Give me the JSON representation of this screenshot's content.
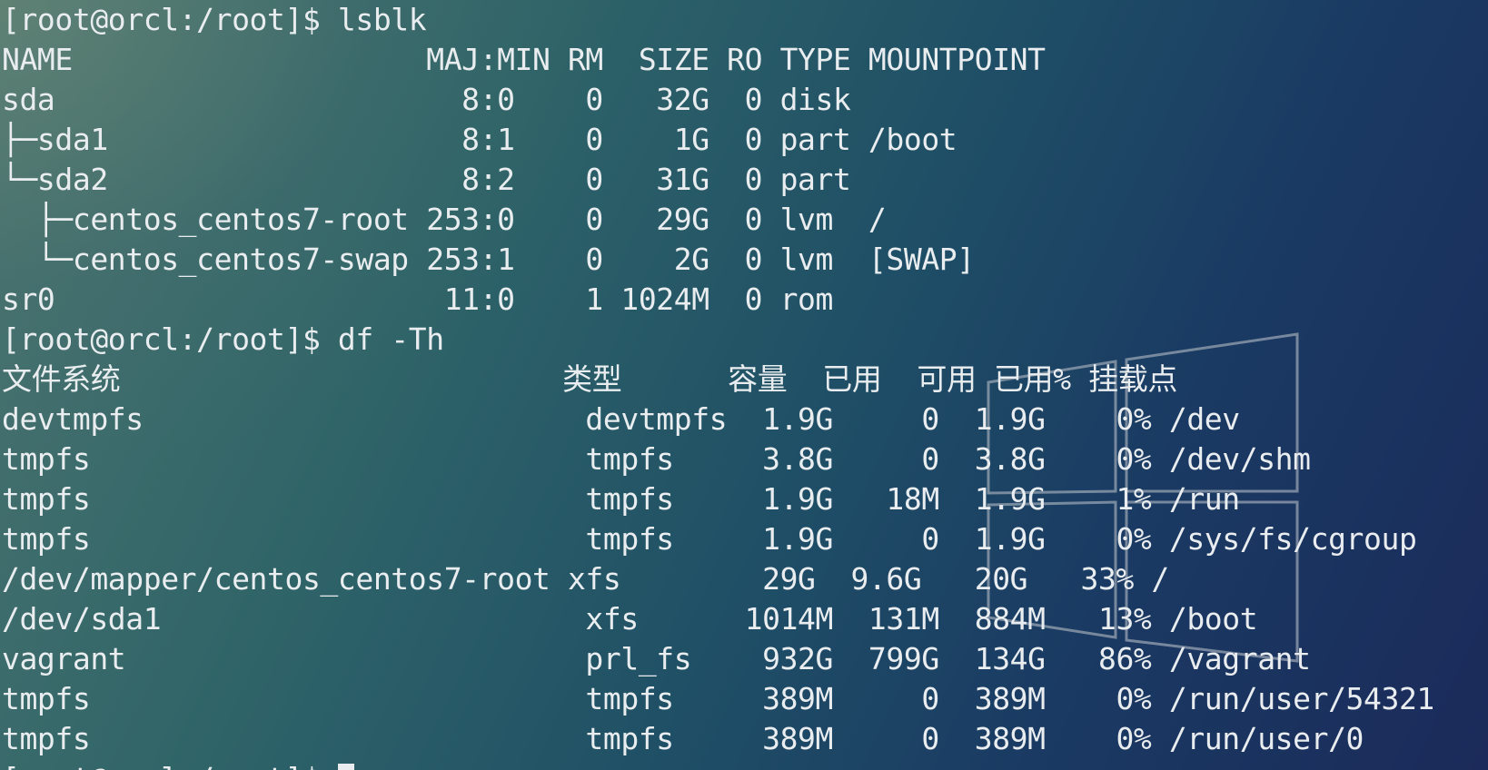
{
  "terminal": {
    "lines": [
      "[root@orcl:/root]$ lsblk",
      "NAME                    MAJ:MIN RM  SIZE RO TYPE MOUNTPOINT",
      "sda                       8:0    0   32G  0 disk",
      "├─sda1                    8:1    0    1G  0 part /boot",
      "└─sda2                    8:2    0   31G  0 part",
      "  ├─centos_centos7-root 253:0    0   29G  0 lvm  /",
      "  └─centos_centos7-swap 253:1    0    2G  0 lvm  [SWAP]",
      "sr0                      11:0    1 1024M  0 rom",
      "[root@orcl:/root]$ df -Th",
      "文件系统                         类型      容量  已用  可用 已用% 挂载点",
      "devtmpfs                         devtmpfs  1.9G     0  1.9G    0% /dev",
      "tmpfs                            tmpfs     3.8G     0  3.8G    0% /dev/shm",
      "tmpfs                            tmpfs     1.9G   18M  1.9G    1% /run",
      "tmpfs                            tmpfs     1.9G     0  1.9G    0% /sys/fs/cgroup",
      "/dev/mapper/centos_centos7-root xfs        29G  9.6G   20G   33% /",
      "/dev/sda1                        xfs      1014M  131M  884M   13% /boot",
      "vagrant                          prl_fs    932G  799G  134G   86% /vagrant",
      "tmpfs                            tmpfs     389M     0  389M    0% /run/user/54321",
      "tmpfs                            tmpfs     389M     0  389M    0% /run/user/0"
    ],
    "prompt": "[root@orcl:/root]$ "
  },
  "colors": {
    "text": "#e9edef",
    "logo_stroke": "#b5bcc4"
  },
  "icons": {
    "wallpaper_logo": "windows-logo-icon"
  }
}
